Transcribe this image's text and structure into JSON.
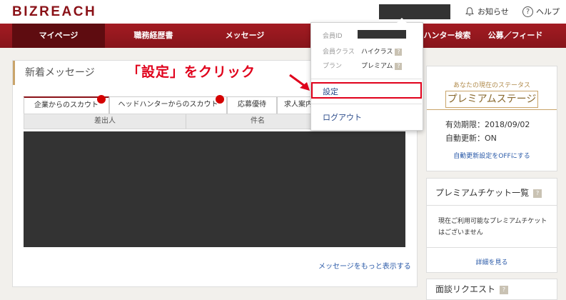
{
  "header": {
    "logo": "BIZREACH",
    "notices_label": "お知らせ",
    "help_label": "ヘルプ"
  },
  "nav": {
    "items": [
      {
        "label": "マイページ"
      },
      {
        "label": "職務経歴書"
      },
      {
        "label": "メッセージ"
      },
      {
        "label": "ヘッドハンター検索"
      },
      {
        "label": "公募／フィード"
      }
    ]
  },
  "main": {
    "title": "新着メッセージ",
    "annotation": "「設定」をクリック",
    "tabs": [
      {
        "label": "企業からのスカウト"
      },
      {
        "label": "ヘッドハンターからのスカウト"
      },
      {
        "label": "応募優待"
      },
      {
        "label": "求人案内"
      }
    ],
    "columns": [
      "差出人",
      "件名"
    ],
    "more_link": "メッセージをもっと表示する"
  },
  "dropdown": {
    "member_id_label": "会員ID",
    "member_class_label": "会員クラス",
    "member_class_value": "ハイクラス",
    "plan_label": "プラン",
    "plan_value": "プレミアム",
    "help_badge": "?",
    "settings_label": "設定",
    "logout_label": "ログアウト"
  },
  "status": {
    "caption": "あなたの現在のステータス",
    "stage": "プレミアムステージ",
    "expiry": "有効期限：2018/09/02",
    "auto_renew": "自動更新：ON",
    "auto_renew_link": "自動更新設定をOFFにする"
  },
  "ticket": {
    "title": "プレミアムチケット一覧",
    "help_badge": "?",
    "body": "現在ご利用可能なプレミアムチケットはございません",
    "detail_link": "詳細を見る"
  },
  "request": {
    "title": "面談リクエスト",
    "help_badge": "?"
  },
  "colors": {
    "brand_red": "#8a1117",
    "nav_red": "#a31b22",
    "annotation_red": "#e0001b",
    "gold": "#c9a46a",
    "link_blue": "#2a5aa8"
  }
}
